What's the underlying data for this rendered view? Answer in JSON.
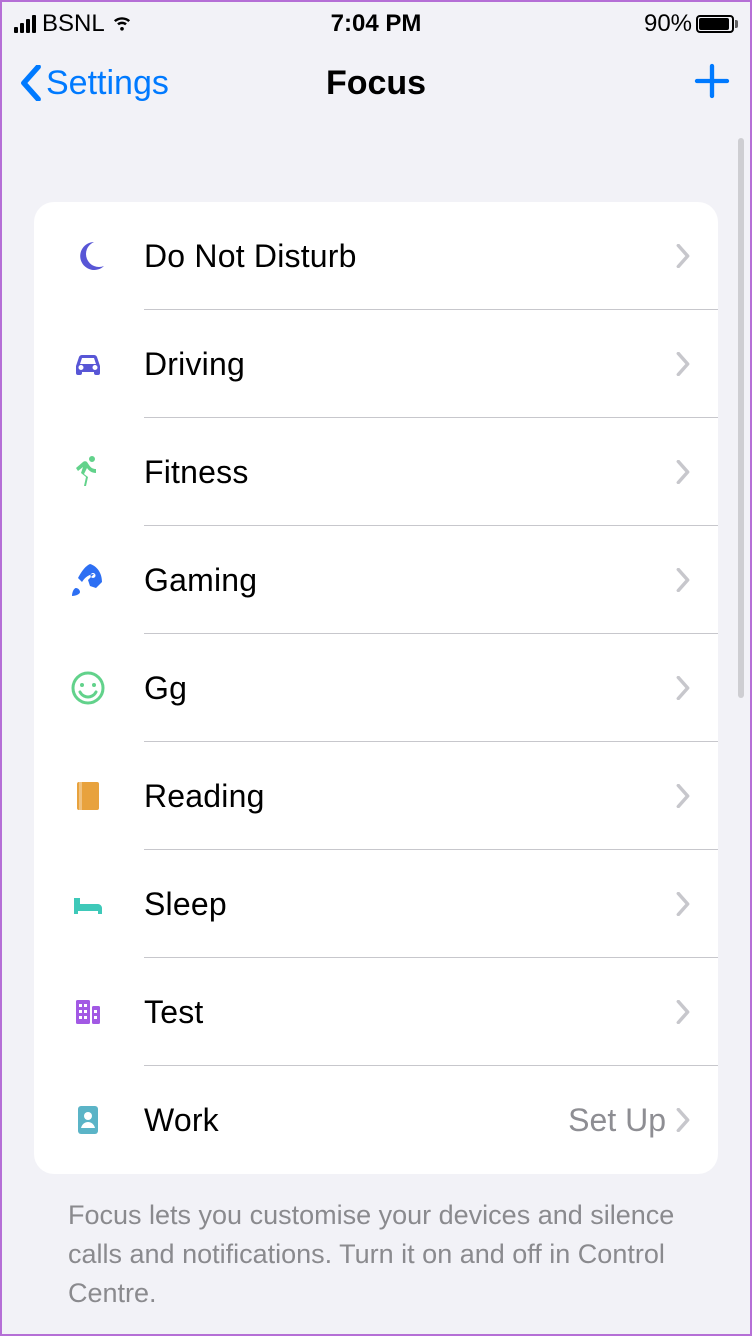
{
  "status": {
    "carrier": "BSNL",
    "time": "7:04 PM",
    "battery_pct": "90%"
  },
  "nav": {
    "back_label": "Settings",
    "title": "Focus"
  },
  "footer": "Focus lets you customise your devices and silence calls and notifications. Turn it on and off in Control Centre.",
  "rows": [
    {
      "icon": "moon",
      "label": "Do Not Disturb",
      "detail": "",
      "colorClass": "c-indigo"
    },
    {
      "icon": "car",
      "label": "Driving",
      "detail": "",
      "colorClass": "c-indigo"
    },
    {
      "icon": "runner",
      "label": "Fitness",
      "detail": "",
      "colorClass": "c-green"
    },
    {
      "icon": "rocket",
      "label": "Gaming",
      "detail": "",
      "colorClass": "c-blue"
    },
    {
      "icon": "smile",
      "label": "Gg",
      "detail": "",
      "colorClass": "c-smile"
    },
    {
      "icon": "book",
      "label": "Reading",
      "detail": "",
      "colorClass": "c-orange"
    },
    {
      "icon": "bed",
      "label": "Sleep",
      "detail": "",
      "colorClass": "c-teal"
    },
    {
      "icon": "building",
      "label": "Test",
      "detail": "",
      "colorClass": "c-purple"
    },
    {
      "icon": "badge",
      "label": "Work",
      "detail": "Set Up",
      "colorClass": "c-slate"
    }
  ]
}
